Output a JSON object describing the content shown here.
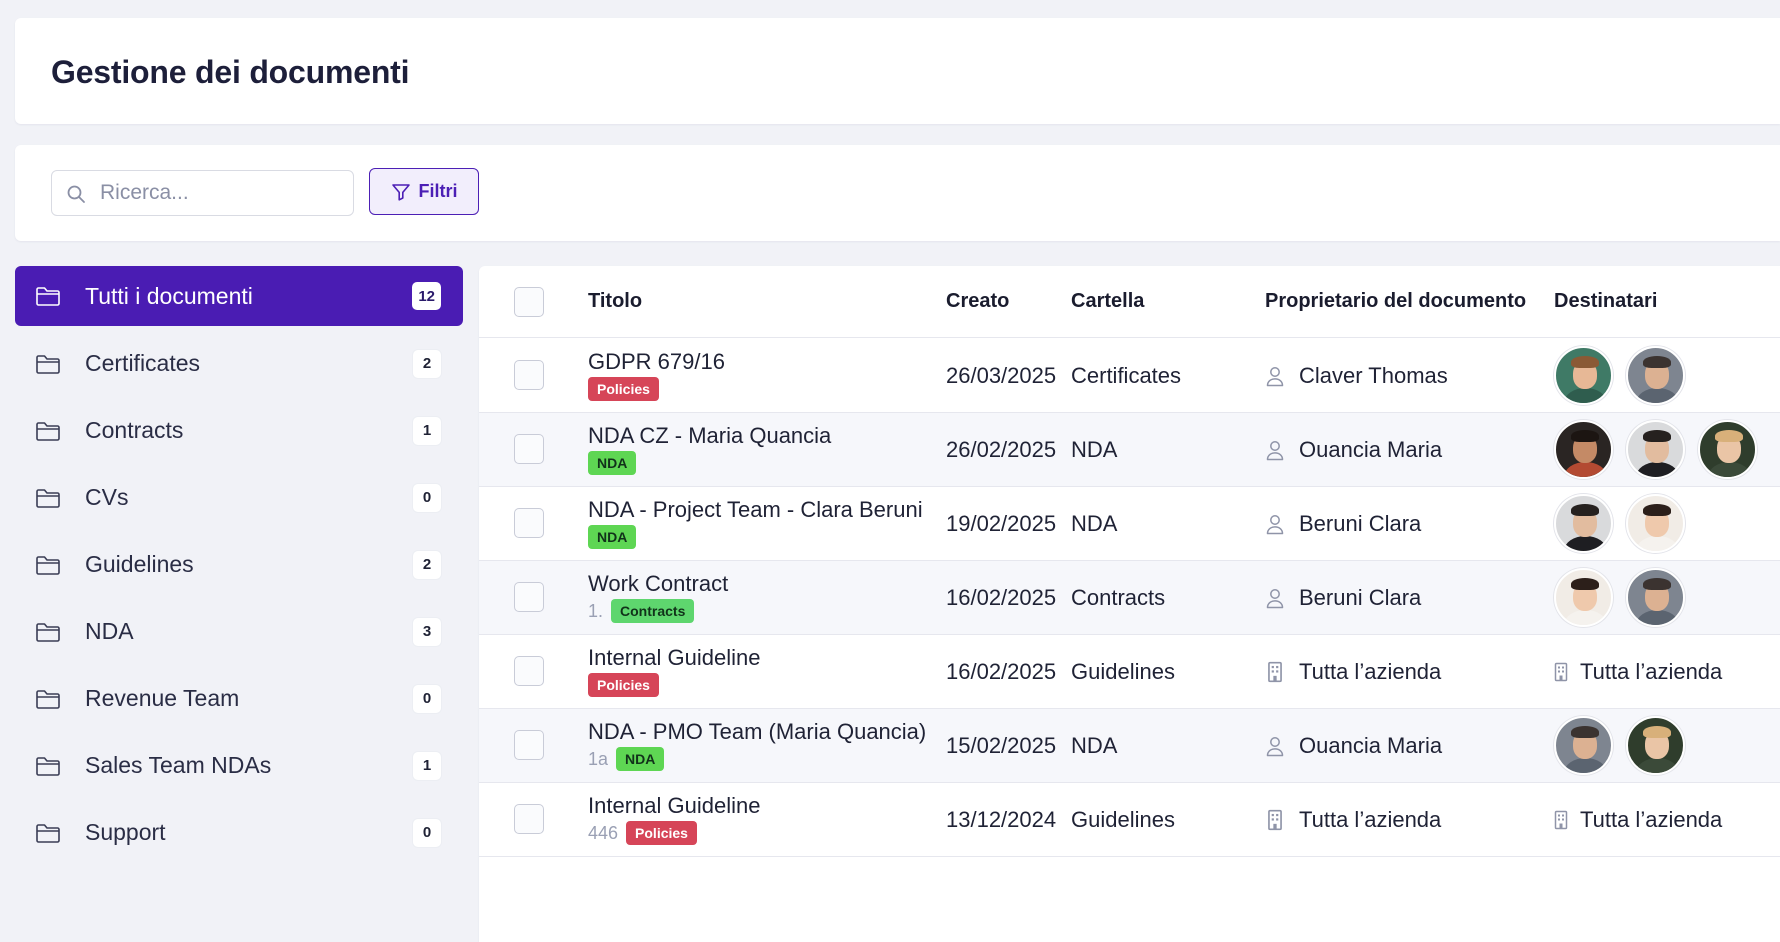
{
  "header": {
    "title": "Gestione dei documenti"
  },
  "toolbar": {
    "search_placeholder": "Ricerca...",
    "filter_label": "Filtri"
  },
  "sidebar": {
    "items": [
      {
        "label": "Tutti i documenti",
        "count": "12",
        "active": true
      },
      {
        "label": "Certificates",
        "count": "2"
      },
      {
        "label": "Contracts",
        "count": "1"
      },
      {
        "label": "CVs",
        "count": "0"
      },
      {
        "label": "Guidelines",
        "count": "2"
      },
      {
        "label": "NDA",
        "count": "3"
      },
      {
        "label": "Revenue Team",
        "count": "0"
      },
      {
        "label": "Sales Team NDAs",
        "count": "1"
      },
      {
        "label": "Support",
        "count": "0"
      }
    ]
  },
  "table": {
    "columns": {
      "title": "Titolo",
      "created": "Creato",
      "folder": "Cartella",
      "owner": "Proprietario del documento",
      "recipients": "Destinatari"
    },
    "rows": [
      {
        "title": "GDPR 679/16",
        "prefix": "",
        "tag": "Policies",
        "tag_type": "policies",
        "created": "26/03/2025",
        "folder": "Certificates",
        "owner": "Claver Thomas",
        "owner_icon": "person-icon",
        "recipients": [
          "avatar-man-glasses",
          "avatar-man-smiling"
        ]
      },
      {
        "title": "NDA CZ - Maria Quancia",
        "prefix": "",
        "tag": "NDA",
        "tag_type": "nda",
        "created": "26/02/2025",
        "folder": "NDA",
        "owner": "Ouancia Maria",
        "owner_icon": "person-icon",
        "recipients": [
          "avatar-man-beard",
          "avatar-man-dark",
          "avatar-woman-blonde"
        ]
      },
      {
        "title": "NDA - Project Team - Clara Beruni",
        "prefix": "",
        "tag": "NDA",
        "tag_type": "nda",
        "created": "19/02/2025",
        "folder": "NDA",
        "owner": "Beruni Clara",
        "owner_icon": "person-icon",
        "recipients": [
          "avatar-man-dark",
          "avatar-woman-bun"
        ]
      },
      {
        "title": "Work Contract",
        "prefix": "1.",
        "tag": "Contracts",
        "tag_type": "contracts",
        "created": "16/02/2025",
        "folder": "Contracts",
        "owner": "Beruni Clara",
        "owner_icon": "person-icon",
        "recipients": [
          "avatar-woman-bun",
          "avatar-man-smiling"
        ]
      },
      {
        "title": "Internal Guideline",
        "prefix": "",
        "tag": "Policies",
        "tag_type": "policies",
        "created": "16/02/2025",
        "folder": "Guidelines",
        "owner": "Tutta l’azienda",
        "owner_icon": "building-icon",
        "recipients_text": "Tutta l’azienda"
      },
      {
        "title": "NDA - PMO Team (Maria Quancia)",
        "prefix": "1a",
        "tag": "NDA",
        "tag_type": "nda",
        "created": "15/02/2025",
        "folder": "NDA",
        "owner": "Ouancia Maria",
        "owner_icon": "person-icon",
        "recipients": [
          "avatar-man-smiling",
          "avatar-woman-blonde"
        ]
      },
      {
        "title": "Internal Guideline",
        "prefix": "446",
        "tag": "Policies",
        "tag_type": "policies",
        "created": "13/12/2024",
        "folder": "Guidelines",
        "owner": "Tutta l’azienda",
        "owner_icon": "building-icon",
        "recipients_text": "Tutta l’azienda"
      }
    ]
  },
  "colors": {
    "accent": "#4a1cb3",
    "policies_tag": "#d64558",
    "nda_tag": "#5ed653",
    "contracts_tag": "#5ed66e"
  }
}
